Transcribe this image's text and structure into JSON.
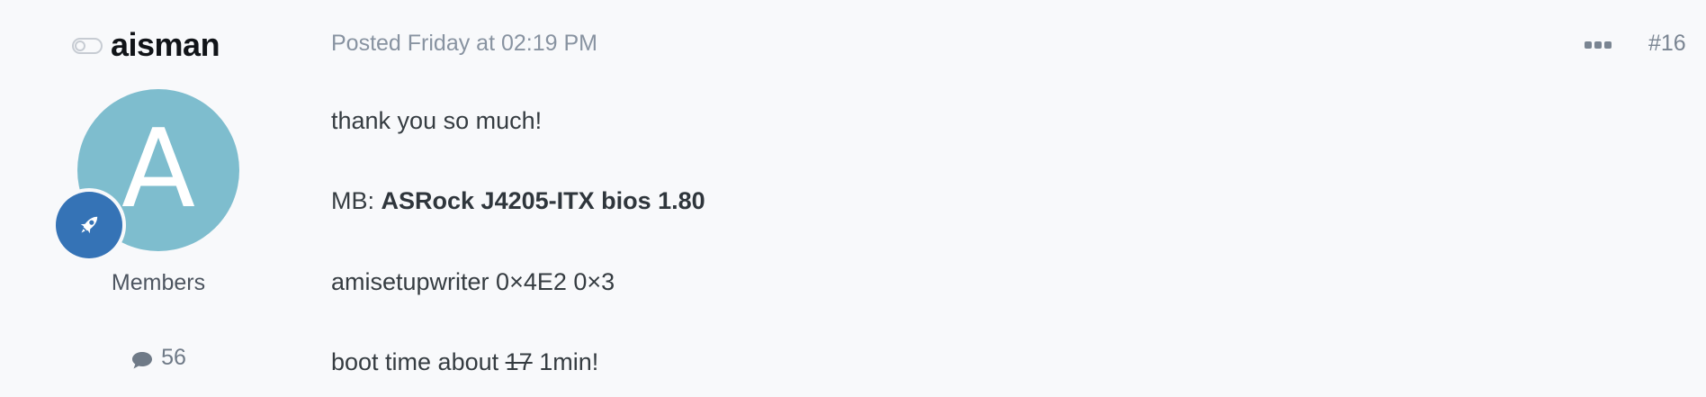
{
  "author": {
    "name": "aisman",
    "avatar_letter": "A",
    "avatar_color": "#7ebdce",
    "rank_icon": "rocket-icon",
    "rank_color": "#3573b6",
    "group": "Members",
    "post_count": "56"
  },
  "post": {
    "meta": "Posted Friday at 02:19 PM",
    "number": "#16",
    "lines": {
      "thanks": "thank you so much!",
      "mb_prefix": "MB: ",
      "mb_value": "ASRock J4205-ITX bios 1.80",
      "command": "amisetupwriter 0×4E2 0×3",
      "boot_prefix": "boot time about ",
      "boot_old": "17",
      "boot_new": " 1min!"
    }
  }
}
